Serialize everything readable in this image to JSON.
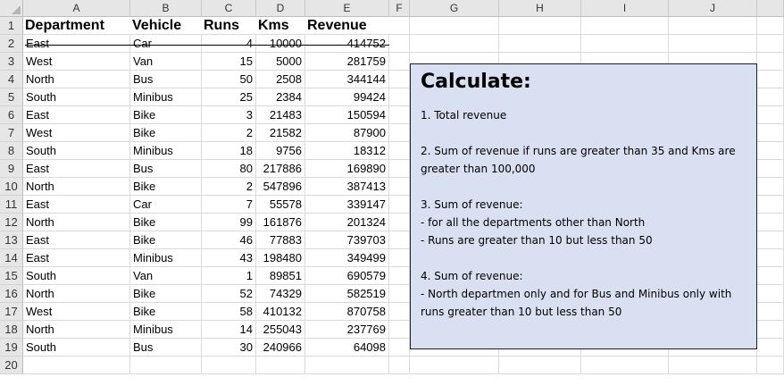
{
  "column_letters": [
    "A",
    "B",
    "C",
    "D",
    "E",
    "F",
    "G",
    "H",
    "I",
    "J"
  ],
  "row_numbers": [
    "1",
    "2",
    "3",
    "4",
    "5",
    "6",
    "7",
    "8",
    "9",
    "10",
    "11",
    "12",
    "13",
    "14",
    "15",
    "16",
    "17",
    "18",
    "19",
    "20"
  ],
  "table": {
    "headers": [
      "Department",
      "Vehicle",
      "Runs",
      "Kms",
      "Revenue"
    ],
    "rows": [
      [
        "East",
        "Car",
        "4",
        "10000",
        "414752"
      ],
      [
        "West",
        "Van",
        "15",
        "5000",
        "281759"
      ],
      [
        "North",
        "Bus",
        "50",
        "2508",
        "344144"
      ],
      [
        "South",
        "Minibus",
        "25",
        "2384",
        "99424"
      ],
      [
        "East",
        "Bike",
        "3",
        "21483",
        "150594"
      ],
      [
        "West",
        "Bike",
        "2",
        "21582",
        "87900"
      ],
      [
        "South",
        "Minibus",
        "18",
        "9756",
        "18312"
      ],
      [
        "East",
        "Bus",
        "80",
        "217886",
        "169890"
      ],
      [
        "North",
        "Bike",
        "2",
        "547896",
        "387413"
      ],
      [
        "East",
        "Car",
        "7",
        "55578",
        "339147"
      ],
      [
        "North",
        "Bike",
        "99",
        "161876",
        "201324"
      ],
      [
        "East",
        "Bike",
        "46",
        "77883",
        "739703"
      ],
      [
        "East",
        "Minibus",
        "43",
        "198480",
        "349499"
      ],
      [
        "South",
        "Van",
        "1",
        "89851",
        "690579"
      ],
      [
        "North",
        "Bike",
        "52",
        "74329",
        "582519"
      ],
      [
        "West",
        "Bike",
        "58",
        "410132",
        "870758"
      ],
      [
        "North",
        "Minibus",
        "14",
        "255043",
        "237769"
      ],
      [
        "South",
        "Bus",
        "30",
        "240966",
        "64098"
      ]
    ]
  },
  "note": {
    "title": "Calculate:",
    "lines": [
      "1. Total revenue",
      "",
      "2. Sum of revenue if runs are greater than 35 and Kms are",
      "greater than 100,000",
      "",
      "3. Sum of revenue:",
      "- for all the departments other than North",
      "- Runs are greater than 10 but less than 50",
      "",
      "4. Sum of revenue:",
      "- North departmen only and for Bus and Minibus only with",
      "runs greater than 10 but less than 50"
    ]
  },
  "colors": {
    "note_bg": "#d9e0f1",
    "header_bg": "#e6e6e6",
    "gridline": "#dadada"
  }
}
